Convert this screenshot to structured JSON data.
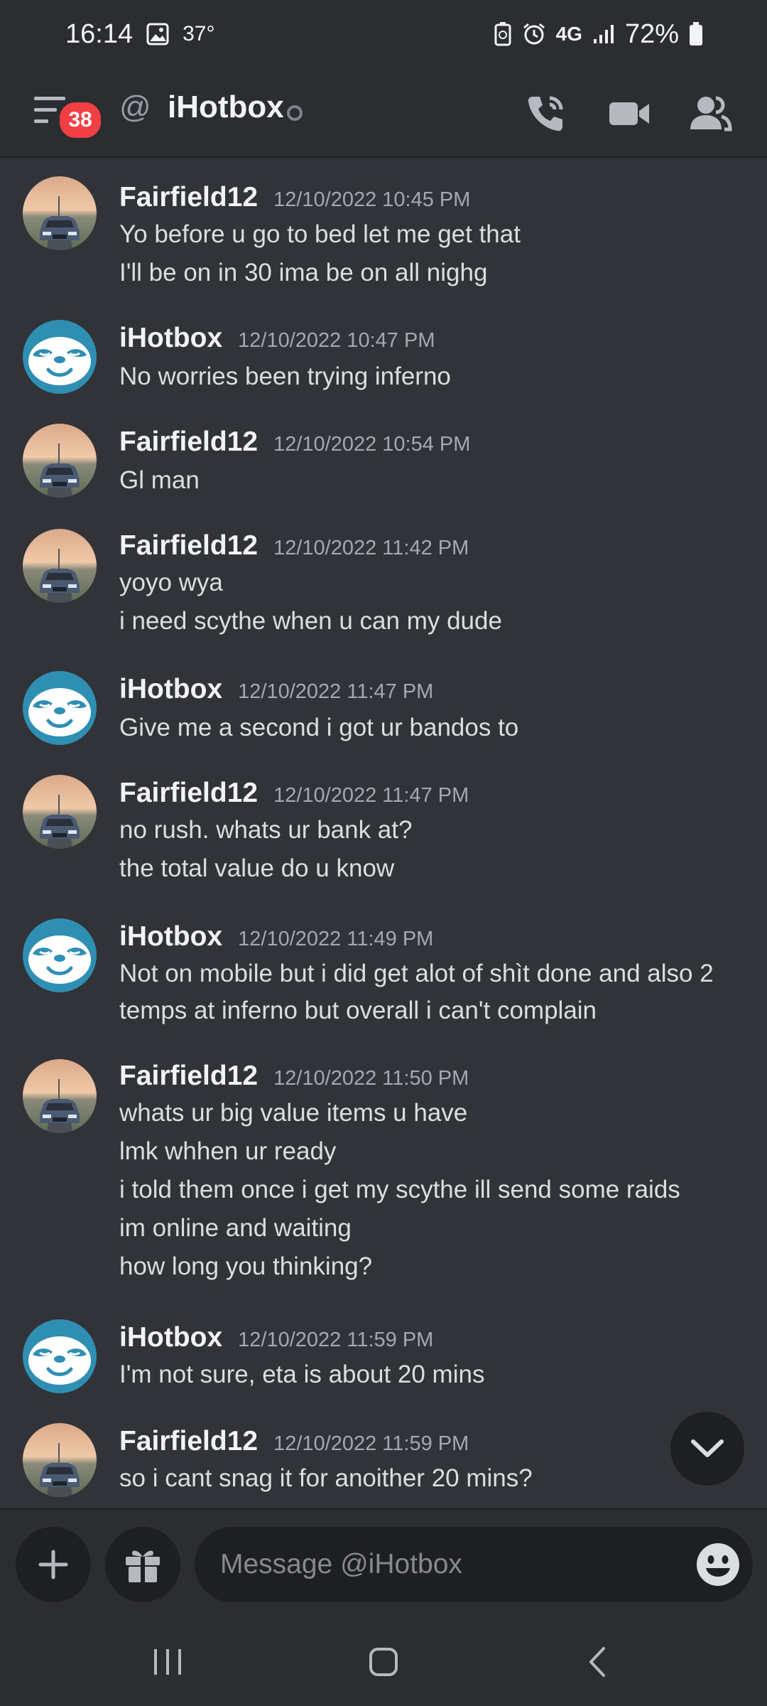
{
  "status_bar": {
    "time": "16:14",
    "temperature": "37°",
    "network": "4G",
    "battery": "72%"
  },
  "header": {
    "notification_count": "38",
    "title": "iHotbox"
  },
  "messages": [
    {
      "author": "Fairfield12",
      "timestamp": "12/10/2022 10:45 PM",
      "avatar": "car",
      "lines": [
        "Yo before u go to bed let me get that",
        "I'll be on in 30 ima be on all nighg"
      ]
    },
    {
      "author": "iHotbox",
      "timestamp": "12/10/2022 10:47 PM",
      "avatar": "sloth",
      "lines": [
        "No worries been trying inferno"
      ]
    },
    {
      "author": "Fairfield12",
      "timestamp": "12/10/2022 10:54 PM",
      "avatar": "car",
      "lines": [
        "Gl man"
      ]
    },
    {
      "author": "Fairfield12",
      "timestamp": "12/10/2022 11:42 PM",
      "avatar": "car",
      "lines": [
        "yoyo wya",
        "i need scythe when u can my dude"
      ]
    },
    {
      "author": "iHotbox",
      "timestamp": "12/10/2022 11:47 PM",
      "avatar": "sloth",
      "lines": [
        "Give me a second i got ur bandos to"
      ]
    },
    {
      "author": "Fairfield12",
      "timestamp": "12/10/2022 11:47 PM",
      "avatar": "car",
      "lines": [
        "no rush. whats ur bank at?",
        "the total value do u know"
      ]
    },
    {
      "author": "iHotbox",
      "timestamp": "12/10/2022 11:49 PM",
      "avatar": "sloth",
      "lines": [
        "Not on mobile but i did get alot of shìt done and also 2",
        "temps at inferno but overall i can't complain"
      ]
    },
    {
      "author": "Fairfield12",
      "timestamp": "12/10/2022 11:50 PM",
      "avatar": "car",
      "lines": [
        "whats ur big  value items u have",
        "lmk whhen ur ready",
        "i told them once i get my scythe ill send some raids",
        "im online and waiting",
        "how long you thinking?"
      ]
    },
    {
      "author": "iHotbox",
      "timestamp": "12/10/2022 11:59 PM",
      "avatar": "sloth",
      "lines": [
        "I'm not sure, eta is about 20 mins"
      ]
    },
    {
      "author": "Fairfield12",
      "timestamp": "12/10/2022 11:59 PM",
      "avatar": "car",
      "lines": [
        "so i cant snag it for anoither 20 mins?"
      ]
    }
  ],
  "composer": {
    "placeholder": "Message @iHotbox"
  },
  "colors": {
    "background": "#313338",
    "header": "#2b2d31",
    "badge": "#f23f43",
    "sloth_avatar": "#2f8fb3"
  }
}
